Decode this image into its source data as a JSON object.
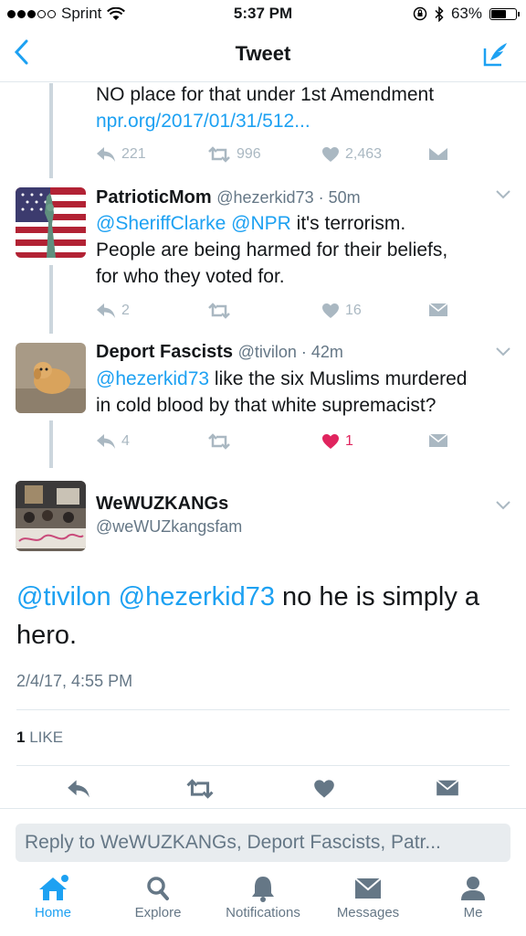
{
  "status_bar": {
    "carrier": "Sprint",
    "time": "5:37 PM",
    "battery": "63%",
    "battery_level": 0.63
  },
  "nav": {
    "title": "Tweet"
  },
  "prev_tweet": {
    "text_line": "NO place for that under 1st Amendment",
    "link": "npr.org/2017/01/31/512...",
    "replies": "221",
    "retweets": "996",
    "likes": "2,463"
  },
  "tweets": [
    {
      "name": "PatrioticMom",
      "handle": "@hezerkid73 · 50m",
      "mention1": "@SheriffClarke",
      "mention2": "@NPR",
      "text_line1": " it's terrorism.",
      "text_line2": "People are being harmed for their beliefs,",
      "text_line3": "for who they voted for.",
      "replies": "2",
      "likes": "16"
    },
    {
      "name": "Deport Fascists",
      "handle": "@tivilon · 42m",
      "mention1": "@hezerkid73",
      "text_line1": " like the six Muslims murdered",
      "text_line2": "in cold blood by that white supremacist?",
      "replies": "4",
      "likes": "1"
    }
  ],
  "main_tweet": {
    "name": "WeWUZKANGs",
    "handle": "@weWUZkangsfam",
    "mention1": "@tivilon",
    "mention2": "@hezerkid73",
    "text": " no he is simply a hero.",
    "timestamp": "2/4/17, 4:55 PM",
    "like_count": "1",
    "like_label": " LIKE"
  },
  "reply": {
    "placeholder": "Reply to WeWUZKANGs, Deport Fascists, Patr..."
  },
  "tabs": [
    {
      "label": "Home",
      "icon": "home-icon"
    },
    {
      "label": "Explore",
      "icon": "search-icon"
    },
    {
      "label": "Notifications",
      "icon": "bell-icon"
    },
    {
      "label": "Messages",
      "icon": "envelope-icon"
    },
    {
      "label": "Me",
      "icon": "person-icon"
    }
  ],
  "colors": {
    "accent": "#1da1f2",
    "like_active": "#e0245e",
    "muted_icon": "#aab8c2",
    "secondary_text": "#657786"
  }
}
